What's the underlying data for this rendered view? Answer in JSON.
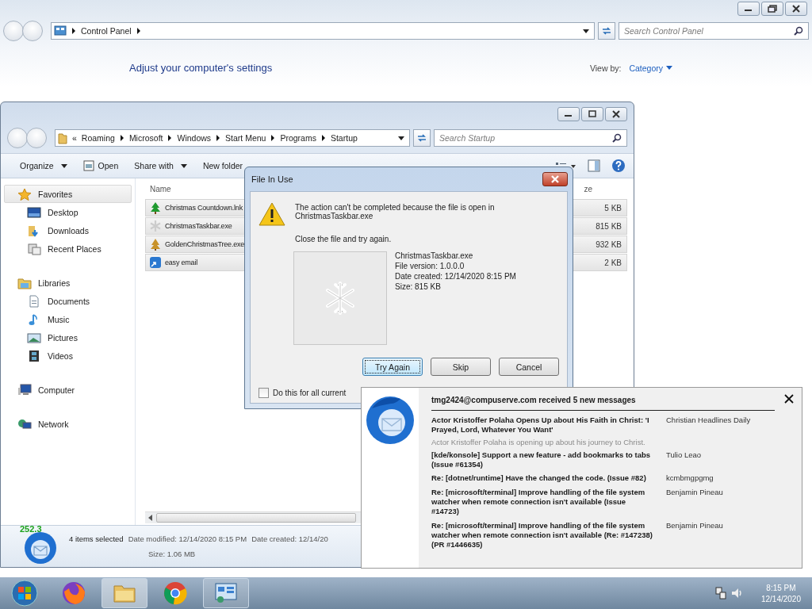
{
  "control_panel": {
    "breadcrumb": [
      "Control Panel"
    ],
    "search_placeholder": "Search Control Panel",
    "heading": "Adjust your computer's settings",
    "view_by_label": "View by:",
    "view_by_value": "Category"
  },
  "explorer": {
    "breadcrumb_prefix": "«",
    "breadcrumb": [
      "Roaming",
      "Microsoft",
      "Windows",
      "Start Menu",
      "Programs",
      "Startup"
    ],
    "search_placeholder": "Search Startup",
    "toolbar": [
      {
        "label": "Organize",
        "dropdown": true
      },
      {
        "label": "Open",
        "dropdown": false
      },
      {
        "label": "Share with",
        "dropdown": true
      },
      {
        "label": "New folder",
        "dropdown": false
      }
    ],
    "sidebar": [
      {
        "label": "Favorites",
        "selected": true,
        "children": [
          {
            "label": "Desktop",
            "selected": false
          },
          {
            "label": "Downloads",
            "selected": false
          },
          {
            "label": "Recent Places",
            "selected": false
          }
        ]
      },
      {
        "label": "Libraries",
        "selected": false,
        "children": [
          {
            "label": "Documents",
            "selected": false
          },
          {
            "label": "Music",
            "selected": false
          },
          {
            "label": "Pictures",
            "selected": false
          },
          {
            "label": "Videos",
            "selected": false
          }
        ]
      },
      {
        "label": "Computer",
        "selected": false
      },
      {
        "label": "Network",
        "selected": false
      }
    ],
    "columns": [
      "Name",
      "ze"
    ],
    "files": [
      {
        "name": "Christmas Countdown.lnk",
        "size": "5 KB",
        "selected": true
      },
      {
        "name": "ChristmasTaskbar.exe",
        "size": "815 KB",
        "selected": true
      },
      {
        "name": "GoldenChristmasTree.exe",
        "size": "932 KB",
        "selected": true
      },
      {
        "name": "easy email",
        "size": "2 KB",
        "selected": true
      }
    ],
    "status": {
      "selection": "4 items selected",
      "modified": "Date modified: 12/14/2020 8:15 PM",
      "created": "Date created: 12/14/20",
      "size": "Size: 1.06 MB"
    },
    "overlay_number": "252.3"
  },
  "dialog": {
    "title": "File In Use",
    "message": "The action can't be completed because the file is open in ChristmasTaskbar.exe",
    "instruction": "Close the file and try again.",
    "details": [
      "ChristmasTaskbar.exe",
      "File version: 1.0.0.0",
      "Date created: 12/14/2020 8:15 PM",
      "Size: 815 KB"
    ],
    "buttons": [
      {
        "label": "Try Again",
        "default": true
      },
      {
        "label": "Skip",
        "default": false
      },
      {
        "label": "Cancel",
        "default": false
      }
    ],
    "checkbox": {
      "label": "Do this for all current",
      "checked": false
    }
  },
  "notification": {
    "header": "tmg2424@compuserve.com received 5 new messages",
    "messages": [
      {
        "subject": "Actor Kristoffer Polaha Opens Up about His Faith in Christ: 'I Prayed, Lord, Whatever You Want'",
        "sender": "Christian Headlines Daily",
        "preview": "Actor Kristoffer Polaha is opening up about his journey to Christ."
      },
      {
        "subject": "[kde/konsole] Support a new feature - add bookmarks to tabs (Issue #61354)",
        "sender": "Tulio Leao"
      },
      {
        "subject": "Re: [dotnet/runtime] Have the changed the code. (Issue #82)",
        "sender": "kcmbmgpgmg"
      },
      {
        "subject": "Re: [microsoft/terminal] Improve handling of the file system watcher when remote connection isn't available (Issue #14723)",
        "sender": "Benjamin Pineau"
      },
      {
        "subject": "Re: [microsoft/terminal] Improve handling of the file system watcher when remote connection isn't available (Re: #147238) (PR #1446635)",
        "sender": "Benjamin Pineau"
      }
    ]
  },
  "taskbar": {
    "items": [
      {
        "open": false,
        "selected": false
      },
      {
        "open": true,
        "selected": true
      },
      {
        "open": false,
        "selected": false
      },
      {
        "open": true,
        "selected": false
      }
    ],
    "time": "8:15 PM",
    "date": "12/14/2020"
  }
}
